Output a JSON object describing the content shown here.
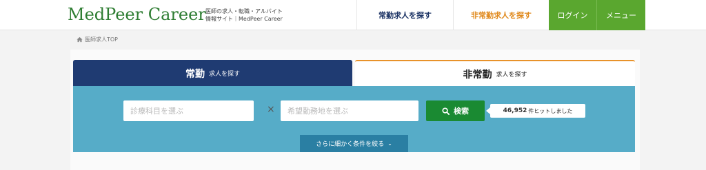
{
  "header": {
    "logo": "MedPeer Career",
    "tagline_line1": "医師の求人・転職・アルバイト",
    "tagline_line2": "情報サイト｜MedPeer Career",
    "nav": {
      "fulltime": "常勤求人を探す",
      "parttime": "非常勤求人を探す",
      "login": "ログイン",
      "menu": "メニュー"
    }
  },
  "breadcrumb": {
    "icon": "home-icon",
    "label": "医師求人TOP"
  },
  "tabs": {
    "fulltime": {
      "main": "常勤",
      "sub": "求人を探す"
    },
    "parttime": {
      "main": "非常勤",
      "sub": "求人を探す"
    }
  },
  "search": {
    "department_placeholder": "診療科目を選ぶ",
    "separator": "×",
    "area_placeholder": "希望勤務地を選ぶ",
    "button_label": "検索",
    "button_icon": "search-icon",
    "result_count": "46,952",
    "result_suffix": "件ヒットしました",
    "more_conditions": "さらに細かく条件を絞る",
    "more_icon": "chevron-down-icon"
  },
  "colors": {
    "brand_green": "#5aa72f",
    "navy": "#1f3b72",
    "orange": "#e08a1e",
    "panel_blue": "#56acc8",
    "search_green": "#1a8a32"
  }
}
